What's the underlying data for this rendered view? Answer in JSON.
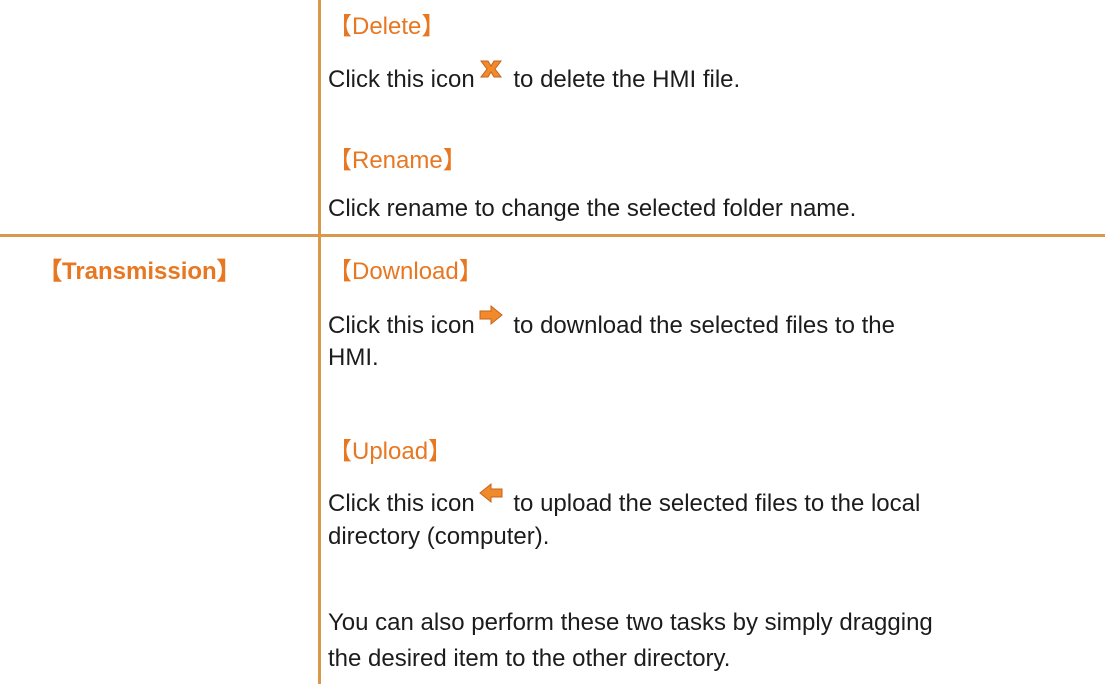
{
  "rows": [
    {
      "title": "",
      "items": [
        {
          "heading": "【Delete】",
          "text_before": "Click this icon",
          "icon": "delete-x-icon",
          "text_after": " to delete the HMI file."
        },
        {
          "heading": "【Rename】",
          "text": "Click rename to change the selected folder name."
        }
      ]
    },
    {
      "title": "【Transmission】",
      "items": [
        {
          "heading": "【Download】",
          "text_before": "Click this icon",
          "icon": "arrow-right-icon",
          "text_after": " to download the selected files to the",
          "text_line2": "HMI."
        },
        {
          "heading": "【Upload】",
          "text_before": "Click this icon",
          "icon": "arrow-left-icon",
          "text_after": " to upload the selected files to the local",
          "text_line2": "directory (computer)."
        },
        {
          "text_line1": "You can also perform these two tasks by simply dragging",
          "text_line2": "the desired item to the other directory."
        }
      ]
    }
  ],
  "colors": {
    "accent": "#e87722",
    "border": "#d89a4a",
    "text": "#1c1c1c"
  }
}
